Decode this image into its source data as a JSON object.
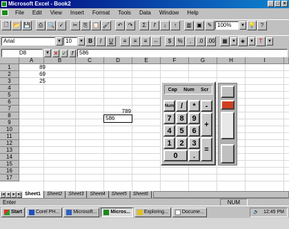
{
  "window": {
    "title": "Microsoft Excel - Book2"
  },
  "menu": [
    "File",
    "Edit",
    "View",
    "Insert",
    "Format",
    "Tools",
    "Data",
    "Window",
    "Help"
  ],
  "toolbar": {
    "zoom": "100%"
  },
  "format": {
    "font": "Arial",
    "size": "10"
  },
  "formula": {
    "name_box": "D8",
    "content": "586"
  },
  "columns": [
    "A",
    "B",
    "C",
    "D",
    "E",
    "F",
    "G",
    "H",
    "I"
  ],
  "rows": [
    "1",
    "2",
    "3",
    "4",
    "5",
    "6",
    "7",
    "8",
    "9",
    "10",
    "11",
    "12",
    "13",
    "14",
    "15",
    "16",
    "17"
  ],
  "cells": {
    "A1": "89",
    "A2": "69",
    "A3": "25",
    "D7": "789",
    "D8": "586"
  },
  "sheets": [
    "Sheet1",
    "Sheet2",
    "Sheet3",
    "Sheet4",
    "Sheet5",
    "Sheet6"
  ],
  "status": {
    "mode": "Enter",
    "num": "NUM"
  },
  "calculator": {
    "indicators": [
      "Cap",
      "Num",
      "Scr"
    ],
    "keys": [
      "Num",
      "/",
      "*",
      "-",
      "7",
      "8",
      "9",
      "+",
      "4",
      "5",
      "6",
      "1",
      "2",
      "3",
      "=",
      "0",
      "."
    ]
  },
  "taskbar": {
    "start": "Start",
    "items": [
      "Corel PH...",
      "Microsoft...",
      "Micros...",
      "Exploring...",
      "Docume..."
    ],
    "time": "12:45 PM"
  }
}
